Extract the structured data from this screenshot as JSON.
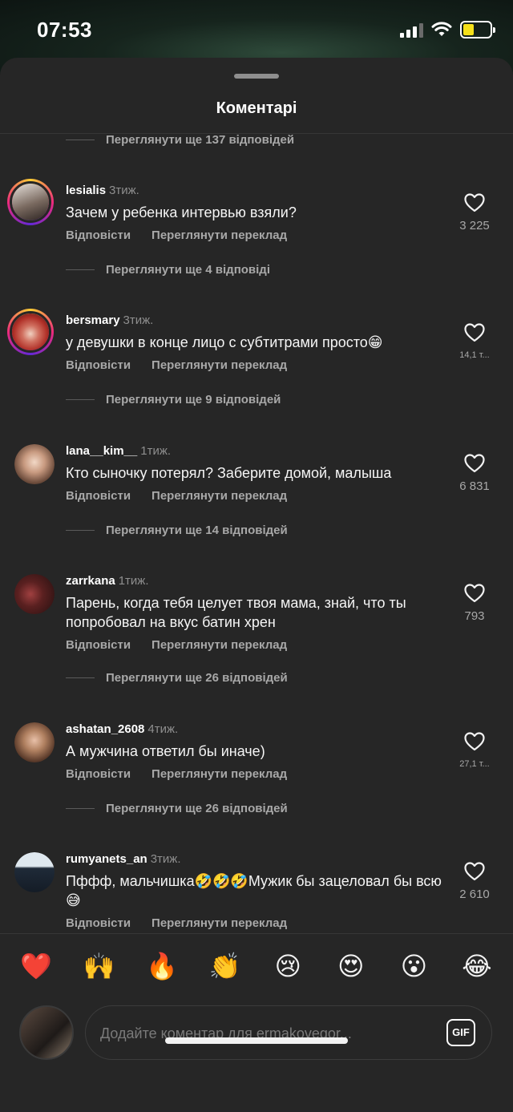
{
  "status_bar": {
    "time": "07:53",
    "battery_level": 0.4,
    "battery_color": "#f4e01a"
  },
  "sheet": {
    "title": "Коментарі"
  },
  "top_replies": "Переглянути ще 137 відповідей",
  "actions": {
    "reply": "Відповісти",
    "translate": "Переглянути переклад"
  },
  "comments": [
    {
      "username": "lesialis",
      "ago": "3тиж.",
      "text": "Зачем у ребенка интервью взяли?",
      "likes": "3 225",
      "replies": "Переглянути ще 4 відповіді"
    },
    {
      "username": "bersmary",
      "ago": "3тиж.",
      "text": "у девушки в конце лицо с субтитрами просто😁",
      "likes": "14,1 т...",
      "replies": "Переглянути ще 9 відповідей"
    },
    {
      "username": "lana__kim__",
      "ago": "1тиж.",
      "text": "Кто сыночку потерял? Заберите домой, малыша",
      "likes": "6 831",
      "replies": "Переглянути ще 14 відповідей"
    },
    {
      "username": "zarrkana",
      "ago": "1тиж.",
      "text": "Парень, когда тебя целует твоя мама, знай, что ты попробовал на вкус батин хрен",
      "likes": "793",
      "replies": "Переглянути ще 26 відповідей"
    },
    {
      "username": "ashatan_2608",
      "ago": "4тиж.",
      "text": "А мужчина ответил бы иначе)",
      "likes": "27,1 т...",
      "replies": "Переглянути ще 26 відповідей"
    },
    {
      "username": "rumyanets_an",
      "ago": "3тиж.",
      "text": "Пффф, мальчишка🤣🤣🤣Мужик бы зацеловал бы всю😅",
      "likes": "2 610"
    }
  ],
  "emoji_bar": [
    "❤️",
    "🙌",
    "🔥",
    "👏",
    "😢",
    "😍",
    "😮",
    "😂"
  ],
  "composer": {
    "placeholder": "Додайте коментар для ermakovegor...",
    "gif_label": "GIF"
  }
}
